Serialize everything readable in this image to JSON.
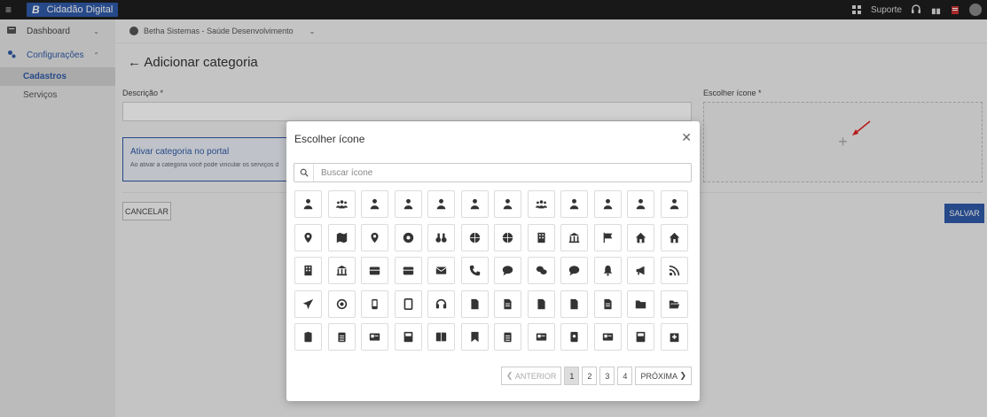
{
  "app": {
    "brand_letter": "B",
    "brand_name": "Cidadão Digital",
    "support_label": "Suporte"
  },
  "sidebar": {
    "items": [
      {
        "label": "Dashboard",
        "icon": "dashboard-icon"
      },
      {
        "label": "Configurações",
        "icon": "gears-icon"
      }
    ],
    "sub_items": [
      {
        "label": "Cadastros",
        "active": true
      },
      {
        "label": "Serviços",
        "active": false
      }
    ]
  },
  "breadcrumb": {
    "org": "Betha Sistemas - Saúde Desenvolvimento"
  },
  "page": {
    "title": "Adicionar categoria",
    "descricao_label": "Descrição *",
    "descricao_value": "",
    "icon_label": "Escolher ícone *",
    "portal_title": "Ativar categoria no portal",
    "portal_desc": "Ao ativar a categoria você pode vincular os serviços d",
    "cancel_label": "CANCELAR",
    "save_label": "SALVAR"
  },
  "modal": {
    "title": "Escolher ícone",
    "search_placeholder": "Buscar ícone",
    "icons": [
      "user-icon",
      "users-group-icon",
      "user-tie-icon",
      "user-graduate-icon",
      "user-secret-icon",
      "user-clock-icon",
      "user-cog-icon",
      "people-icon",
      "male-icon",
      "female-icon",
      "child-icon",
      "walking-icon",
      "map-marker-icon",
      "map-icon",
      "map-pin-icon",
      "compass-icon",
      "binoculars-icon",
      "globe-grid-icon",
      "globe-icon",
      "city-icon",
      "landmark-icon",
      "flag-icon",
      "home-icon",
      "house-icon",
      "building-icon",
      "university-icon",
      "archive-icon",
      "warehouse-icon",
      "envelope-icon",
      "phone-icon",
      "comment-icon",
      "comments-icon",
      "comment-alt-icon",
      "bell-icon",
      "bullhorn-icon",
      "rss-icon",
      "paper-plane-icon",
      "at-icon",
      "mobile-icon",
      "tablet-icon",
      "headset-icon",
      "file-icon",
      "file-alt-icon",
      "file-pdf-icon",
      "file-image-icon",
      "file-download-icon",
      "folder-icon",
      "folder-open-icon",
      "clipboard-icon",
      "clipboard-list-icon",
      "newspaper-icon",
      "book-icon",
      "book-open-icon",
      "bookmark-icon",
      "list-doc-icon",
      "id-card-icon",
      "id-badge-icon",
      "address-card-icon",
      "address-book-icon",
      "hospital-icon"
    ],
    "pager": {
      "prev": "ANTERIOR",
      "pages": [
        "1",
        "2",
        "3",
        "4"
      ],
      "current": "1",
      "next": "PRÓXIMA"
    }
  },
  "colors": {
    "accent": "#2f5aa8",
    "icon_fill": "#333333",
    "arrow": "#e02020"
  }
}
